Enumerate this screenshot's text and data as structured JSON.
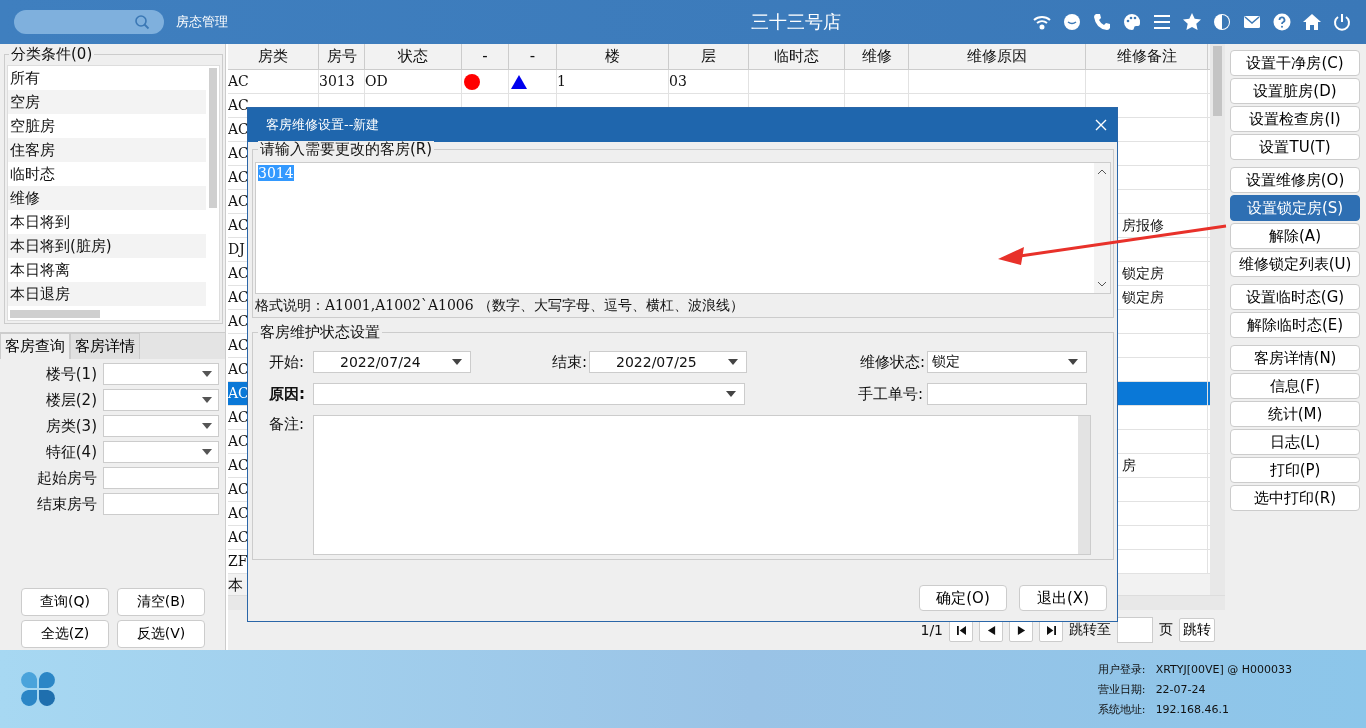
{
  "top_bar": {
    "module": "房态管理",
    "store": "三十三号店"
  },
  "left_panel": {
    "legend": "分类条件(0)",
    "categories": [
      "所有",
      "空房",
      "空脏房",
      "住客房",
      "临时态",
      "维修",
      "本日将到",
      "本日将到(脏房)",
      "本日将离",
      "本日退房"
    ],
    "tabs": [
      {
        "label": "客房查询",
        "selected": true
      },
      {
        "label": "客房详情",
        "selected": false
      }
    ],
    "fields": [
      {
        "label": "楼号(1)",
        "kind": "select"
      },
      {
        "label": "楼层(2)",
        "kind": "select"
      },
      {
        "label": "房类(3)",
        "kind": "select"
      },
      {
        "label": "特征(4)",
        "kind": "select"
      },
      {
        "label": "起始房号",
        "kind": "text"
      },
      {
        "label": "结束房号",
        "kind": "text"
      }
    ],
    "buttons": [
      "查询(Q)",
      "清空(B)",
      "全选(Z)",
      "反选(V)"
    ]
  },
  "table": {
    "columns": [
      "房类",
      "房号",
      "状态",
      "-",
      "-",
      "楼",
      "层",
      "临时态",
      "维修",
      "维修原因",
      "维修备注"
    ],
    "rows": [
      {
        "type": "AC",
        "room": "3013",
        "status": "OD",
        "dot": true,
        "triangle": true,
        "building": "1",
        "floor": "03",
        "selected": false
      },
      {
        "type": "AC",
        "selected": false
      },
      {
        "type": "AC",
        "selected": false
      },
      {
        "type": "AC",
        "selected": false
      },
      {
        "type": "AC",
        "selected": false
      },
      {
        "type": "AC",
        "selected": false
      },
      {
        "type": "AC",
        "remark": "房报修",
        "selected": false
      },
      {
        "type": "DJ",
        "selected": false
      },
      {
        "type": "AC",
        "remark": "锁定房",
        "selected": false
      },
      {
        "type": "AC",
        "remark": "锁定房",
        "selected": false
      },
      {
        "type": "AC",
        "selected": false
      },
      {
        "type": "AC",
        "selected": false
      },
      {
        "type": "AC",
        "selected": false
      },
      {
        "type": "AC",
        "selected": true
      },
      {
        "type": "AC",
        "selected": false
      },
      {
        "type": "AC",
        "selected": false
      },
      {
        "type": "AC",
        "remark": "房",
        "selected": false
      },
      {
        "type": "AC",
        "selected": false
      },
      {
        "type": "AC",
        "selected": false
      },
      {
        "type": "AC",
        "selected": false
      },
      {
        "type": "ZF",
        "selected": false
      }
    ],
    "footer_text": "本"
  },
  "pager": {
    "page": "1/1",
    "jump_label": "跳转至",
    "page_unit": "页",
    "jump_button": "跳转"
  },
  "right_buttons": [
    [
      {
        "label": "设置干净房(C)",
        "selected": false
      },
      {
        "label": "设置脏房(D)",
        "selected": false
      },
      {
        "label": "设置检查房(I)",
        "selected": false
      },
      {
        "label": "设置TU(T)",
        "selected": false
      }
    ],
    [
      {
        "label": "设置维修房(O)",
        "selected": false
      },
      {
        "label": "设置锁定房(S)",
        "selected": true
      },
      {
        "label": "解除(A)",
        "selected": false
      },
      {
        "label": "维修锁定列表(U)",
        "selected": false
      }
    ],
    [
      {
        "label": "设置临时态(G)",
        "selected": false
      },
      {
        "label": "解除临时态(E)",
        "selected": false
      }
    ],
    [
      {
        "label": "客房详情(N)",
        "selected": false
      },
      {
        "label": "信息(F)",
        "selected": false
      },
      {
        "label": "统计(M)",
        "selected": false
      },
      {
        "label": "日志(L)",
        "selected": false
      },
      {
        "label": "打印(P)",
        "selected": false
      },
      {
        "label": "选中打印(R)",
        "selected": false
      }
    ]
  ],
  "dialog": {
    "title": "客房维修设置--新建",
    "rooms_legend": "请输入需要更改的客房(R)",
    "rooms_value": "3014",
    "hint": "格式说明：A1001,A1002`A1006 （数字、大写字母、逗号、横杠、波浪线）",
    "status_legend": "客房维护状态设置",
    "start_label": "开始:",
    "start": "2022/07/24",
    "end_label": "结束:",
    "end": "2022/07/25",
    "state_label": "维修状态:",
    "state": "锁定",
    "reason_label": "原因:",
    "manual_label": "手工单号:",
    "note_label": "备注:",
    "buttons": [
      "确定(O)",
      "退出(X)"
    ]
  },
  "footer": {
    "info": [
      {
        "label": "用户登录:",
        "value": "XRTYJ[00VE] @ H000033"
      },
      {
        "label": "营业日期:",
        "value": "22-07-24"
      },
      {
        "label": "系统地址:",
        "value": "192.168.46.1"
      }
    ]
  }
}
